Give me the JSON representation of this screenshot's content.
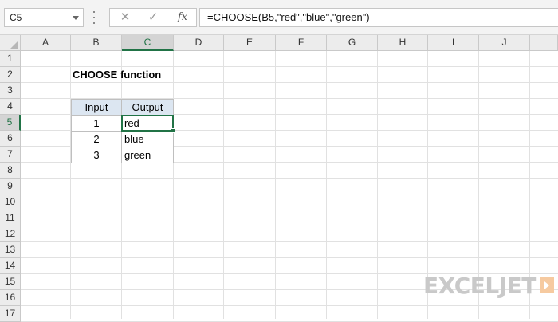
{
  "name_box": {
    "value": "C5"
  },
  "formula_bar": {
    "cancel_glyph": "✕",
    "enter_glyph": "✓",
    "fx_label": "fx",
    "formula": "=CHOOSE(B5,\"red\",\"blue\",\"green\")"
  },
  "columns": [
    "A",
    "B",
    "C",
    "D",
    "E",
    "F",
    "G",
    "H",
    "I",
    "J"
  ],
  "rows": [
    "1",
    "2",
    "3",
    "4",
    "5",
    "6",
    "7",
    "8",
    "9",
    "10",
    "11",
    "12",
    "13",
    "14",
    "15",
    "16",
    "17"
  ],
  "selected": {
    "column": "C",
    "row": "5"
  },
  "sheet": {
    "title": "CHOOSE function",
    "table": {
      "headers": [
        "Input",
        "Output"
      ],
      "rows": [
        {
          "input": "1",
          "output": "red"
        },
        {
          "input": "2",
          "output": "blue"
        },
        {
          "input": "3",
          "output": "green"
        }
      ]
    }
  },
  "logo": {
    "text": "EXCELJET",
    "icon": "exceljet-arrow-icon"
  },
  "colors": {
    "accent": "#217346",
    "table_header_fill": "#dce6f1",
    "logo_gray": "#c9c9c9",
    "logo_orange": "#f6caa0"
  }
}
